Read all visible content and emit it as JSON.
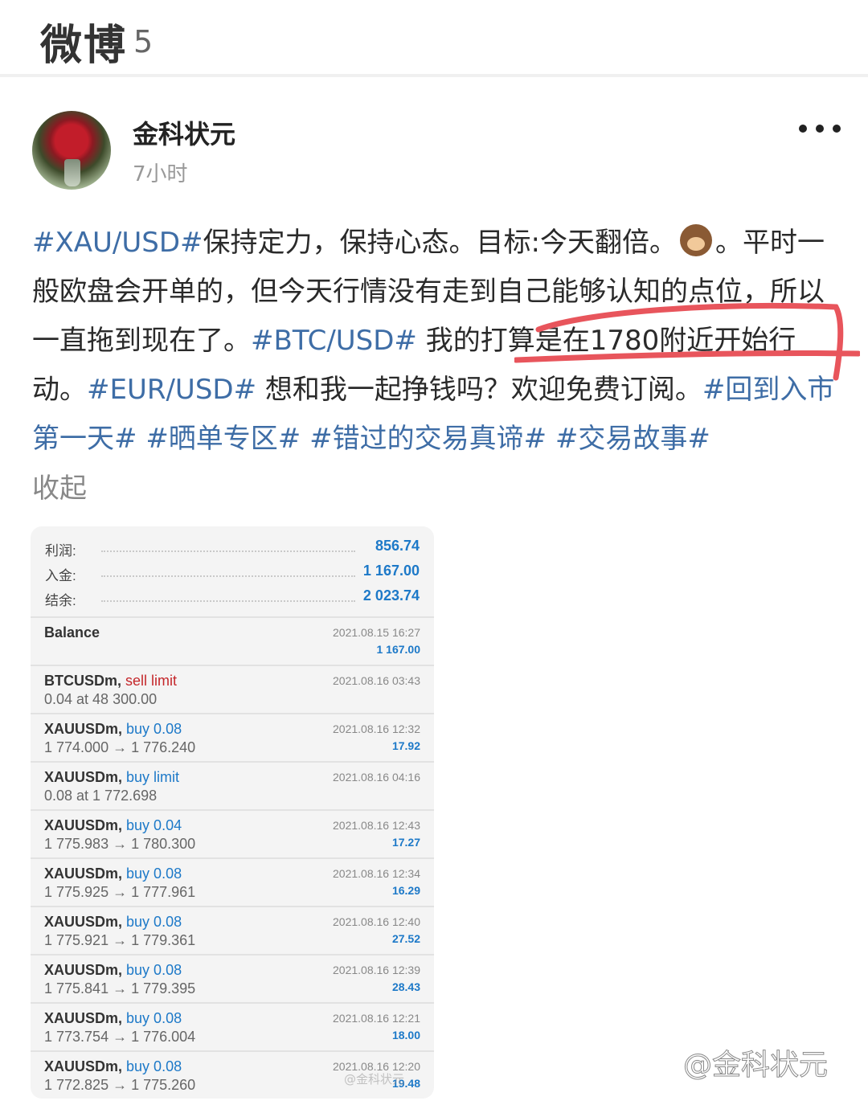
{
  "header": {
    "app_name": "微博",
    "count": "5"
  },
  "post": {
    "author": "金科状元",
    "time": "7小时",
    "segments": [
      {
        "t": "#XAU/USD#",
        "tag": true
      },
      {
        "t": "保持定力，保持心态。目标:今天翻倍。",
        "tag": false
      },
      {
        "t": "",
        "emoji": "see-no-evil-monkey-icon"
      },
      {
        "t": "。平时一般欧盘会开单的，但今天行情没有走到自己能够认知的点位，所以一直拖到现在了。",
        "tag": false
      },
      {
        "t": "#BTC/USD#",
        "tag": true
      },
      {
        "t": " 我的打算是在1780附近开始行动。",
        "tag": false
      },
      {
        "t": "#EUR/USD#",
        "tag": true
      },
      {
        "t": " 想和我一起挣钱吗？欢迎免费订阅。",
        "tag": false
      },
      {
        "t": "#回到入市第一天#",
        "tag": true
      },
      {
        "t": " ",
        "tag": false
      },
      {
        "t": "#晒单专区#",
        "tag": true
      },
      {
        "t": " ",
        "tag": false
      },
      {
        "t": "#错过的交易真谛#",
        "tag": true
      },
      {
        "t": " ",
        "tag": false
      },
      {
        "t": "#交易故事#",
        "tag": true
      }
    ],
    "collapse_label": "收起",
    "annotation_color": "#e8555c"
  },
  "statement": {
    "summary": [
      {
        "label": "利润:",
        "value": "856.74"
      },
      {
        "label": "入金:",
        "value": "1 167.00"
      },
      {
        "label": "结余:",
        "value": "2 023.74"
      }
    ],
    "trades": [
      {
        "symbol": "Balance",
        "action": "",
        "action_color": "blue",
        "detail": "",
        "datetime": "2021.08.15 16:27",
        "profit": "1 167.00"
      },
      {
        "symbol": "BTCUSDm,",
        "action": "sell limit",
        "action_color": "red",
        "detail": "0.04 at 48 300.00",
        "datetime": "2021.08.16 03:43",
        "profit": ""
      },
      {
        "symbol": "XAUUSDm,",
        "action": "buy 0.08",
        "action_color": "blue",
        "detail": "1 774.000 → 1 776.240",
        "datetime": "2021.08.16 12:32",
        "profit": "17.92"
      },
      {
        "symbol": "XAUUSDm,",
        "action": "buy limit",
        "action_color": "blue",
        "detail": "0.08 at 1 772.698",
        "datetime": "2021.08.16 04:16",
        "profit": ""
      },
      {
        "symbol": "XAUUSDm,",
        "action": "buy 0.04",
        "action_color": "blue",
        "detail": "1 775.983 → 1 780.300",
        "datetime": "2021.08.16 12:43",
        "profit": "17.27"
      },
      {
        "symbol": "XAUUSDm,",
        "action": "buy 0.08",
        "action_color": "blue",
        "detail": "1 775.925 → 1 777.961",
        "datetime": "2021.08.16 12:34",
        "profit": "16.29"
      },
      {
        "symbol": "XAUUSDm,",
        "action": "buy 0.08",
        "action_color": "blue",
        "detail": "1 775.921 → 1 779.361",
        "datetime": "2021.08.16 12:40",
        "profit": "27.52"
      },
      {
        "symbol": "XAUUSDm,",
        "action": "buy 0.08",
        "action_color": "blue",
        "detail": "1 775.841 → 1 779.395",
        "datetime": "2021.08.16 12:39",
        "profit": "28.43"
      },
      {
        "symbol": "XAUUSDm,",
        "action": "buy 0.08",
        "action_color": "blue",
        "detail": "1 773.754 → 1 776.004",
        "datetime": "2021.08.16 12:21",
        "profit": "18.00"
      },
      {
        "symbol": "XAUUSDm,",
        "action": "buy 0.08",
        "action_color": "blue",
        "detail": "1 772.825 → 1 775.260",
        "datetime": "2021.08.16 12:20",
        "profit": "19.48"
      }
    ]
  },
  "watermarks": {
    "card": "@金科状元",
    "page": "@金科状元"
  },
  "colors": {
    "link": "#3e6da6",
    "value_blue": "#1d79c8",
    "sell_red": "#c4272b"
  }
}
